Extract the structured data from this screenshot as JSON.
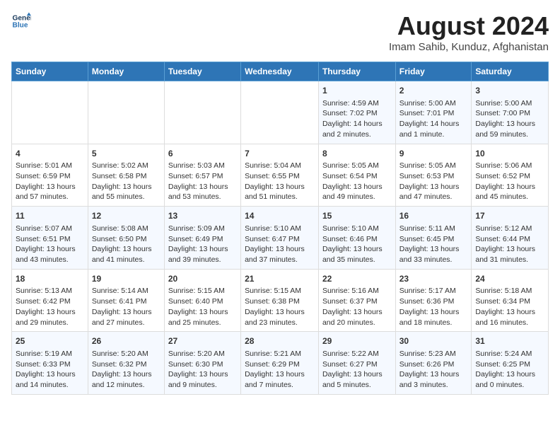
{
  "header": {
    "logo_line1": "General",
    "logo_line2": "Blue",
    "main_title": "August 2024",
    "subtitle": "Imam Sahib, Kunduz, Afghanistan"
  },
  "weekdays": [
    "Sunday",
    "Monday",
    "Tuesday",
    "Wednesday",
    "Thursday",
    "Friday",
    "Saturday"
  ],
  "weeks": [
    [
      {
        "day": "",
        "info": ""
      },
      {
        "day": "",
        "info": ""
      },
      {
        "day": "",
        "info": ""
      },
      {
        "day": "",
        "info": ""
      },
      {
        "day": "1",
        "info": "Sunrise: 4:59 AM\nSunset: 7:02 PM\nDaylight: 14 hours\nand 2 minutes."
      },
      {
        "day": "2",
        "info": "Sunrise: 5:00 AM\nSunset: 7:01 PM\nDaylight: 14 hours\nand 1 minute."
      },
      {
        "day": "3",
        "info": "Sunrise: 5:00 AM\nSunset: 7:00 PM\nDaylight: 13 hours\nand 59 minutes."
      }
    ],
    [
      {
        "day": "4",
        "info": "Sunrise: 5:01 AM\nSunset: 6:59 PM\nDaylight: 13 hours\nand 57 minutes."
      },
      {
        "day": "5",
        "info": "Sunrise: 5:02 AM\nSunset: 6:58 PM\nDaylight: 13 hours\nand 55 minutes."
      },
      {
        "day": "6",
        "info": "Sunrise: 5:03 AM\nSunset: 6:57 PM\nDaylight: 13 hours\nand 53 minutes."
      },
      {
        "day": "7",
        "info": "Sunrise: 5:04 AM\nSunset: 6:55 PM\nDaylight: 13 hours\nand 51 minutes."
      },
      {
        "day": "8",
        "info": "Sunrise: 5:05 AM\nSunset: 6:54 PM\nDaylight: 13 hours\nand 49 minutes."
      },
      {
        "day": "9",
        "info": "Sunrise: 5:05 AM\nSunset: 6:53 PM\nDaylight: 13 hours\nand 47 minutes."
      },
      {
        "day": "10",
        "info": "Sunrise: 5:06 AM\nSunset: 6:52 PM\nDaylight: 13 hours\nand 45 minutes."
      }
    ],
    [
      {
        "day": "11",
        "info": "Sunrise: 5:07 AM\nSunset: 6:51 PM\nDaylight: 13 hours\nand 43 minutes."
      },
      {
        "day": "12",
        "info": "Sunrise: 5:08 AM\nSunset: 6:50 PM\nDaylight: 13 hours\nand 41 minutes."
      },
      {
        "day": "13",
        "info": "Sunrise: 5:09 AM\nSunset: 6:49 PM\nDaylight: 13 hours\nand 39 minutes."
      },
      {
        "day": "14",
        "info": "Sunrise: 5:10 AM\nSunset: 6:47 PM\nDaylight: 13 hours\nand 37 minutes."
      },
      {
        "day": "15",
        "info": "Sunrise: 5:10 AM\nSunset: 6:46 PM\nDaylight: 13 hours\nand 35 minutes."
      },
      {
        "day": "16",
        "info": "Sunrise: 5:11 AM\nSunset: 6:45 PM\nDaylight: 13 hours\nand 33 minutes."
      },
      {
        "day": "17",
        "info": "Sunrise: 5:12 AM\nSunset: 6:44 PM\nDaylight: 13 hours\nand 31 minutes."
      }
    ],
    [
      {
        "day": "18",
        "info": "Sunrise: 5:13 AM\nSunset: 6:42 PM\nDaylight: 13 hours\nand 29 minutes."
      },
      {
        "day": "19",
        "info": "Sunrise: 5:14 AM\nSunset: 6:41 PM\nDaylight: 13 hours\nand 27 minutes."
      },
      {
        "day": "20",
        "info": "Sunrise: 5:15 AM\nSunset: 6:40 PM\nDaylight: 13 hours\nand 25 minutes."
      },
      {
        "day": "21",
        "info": "Sunrise: 5:15 AM\nSunset: 6:38 PM\nDaylight: 13 hours\nand 23 minutes."
      },
      {
        "day": "22",
        "info": "Sunrise: 5:16 AM\nSunset: 6:37 PM\nDaylight: 13 hours\nand 20 minutes."
      },
      {
        "day": "23",
        "info": "Sunrise: 5:17 AM\nSunset: 6:36 PM\nDaylight: 13 hours\nand 18 minutes."
      },
      {
        "day": "24",
        "info": "Sunrise: 5:18 AM\nSunset: 6:34 PM\nDaylight: 13 hours\nand 16 minutes."
      }
    ],
    [
      {
        "day": "25",
        "info": "Sunrise: 5:19 AM\nSunset: 6:33 PM\nDaylight: 13 hours\nand 14 minutes."
      },
      {
        "day": "26",
        "info": "Sunrise: 5:20 AM\nSunset: 6:32 PM\nDaylight: 13 hours\nand 12 minutes."
      },
      {
        "day": "27",
        "info": "Sunrise: 5:20 AM\nSunset: 6:30 PM\nDaylight: 13 hours\nand 9 minutes."
      },
      {
        "day": "28",
        "info": "Sunrise: 5:21 AM\nSunset: 6:29 PM\nDaylight: 13 hours\nand 7 minutes."
      },
      {
        "day": "29",
        "info": "Sunrise: 5:22 AM\nSunset: 6:27 PM\nDaylight: 13 hours\nand 5 minutes."
      },
      {
        "day": "30",
        "info": "Sunrise: 5:23 AM\nSunset: 6:26 PM\nDaylight: 13 hours\nand 3 minutes."
      },
      {
        "day": "31",
        "info": "Sunrise: 5:24 AM\nSunset: 6:25 PM\nDaylight: 13 hours\nand 0 minutes."
      }
    ]
  ]
}
